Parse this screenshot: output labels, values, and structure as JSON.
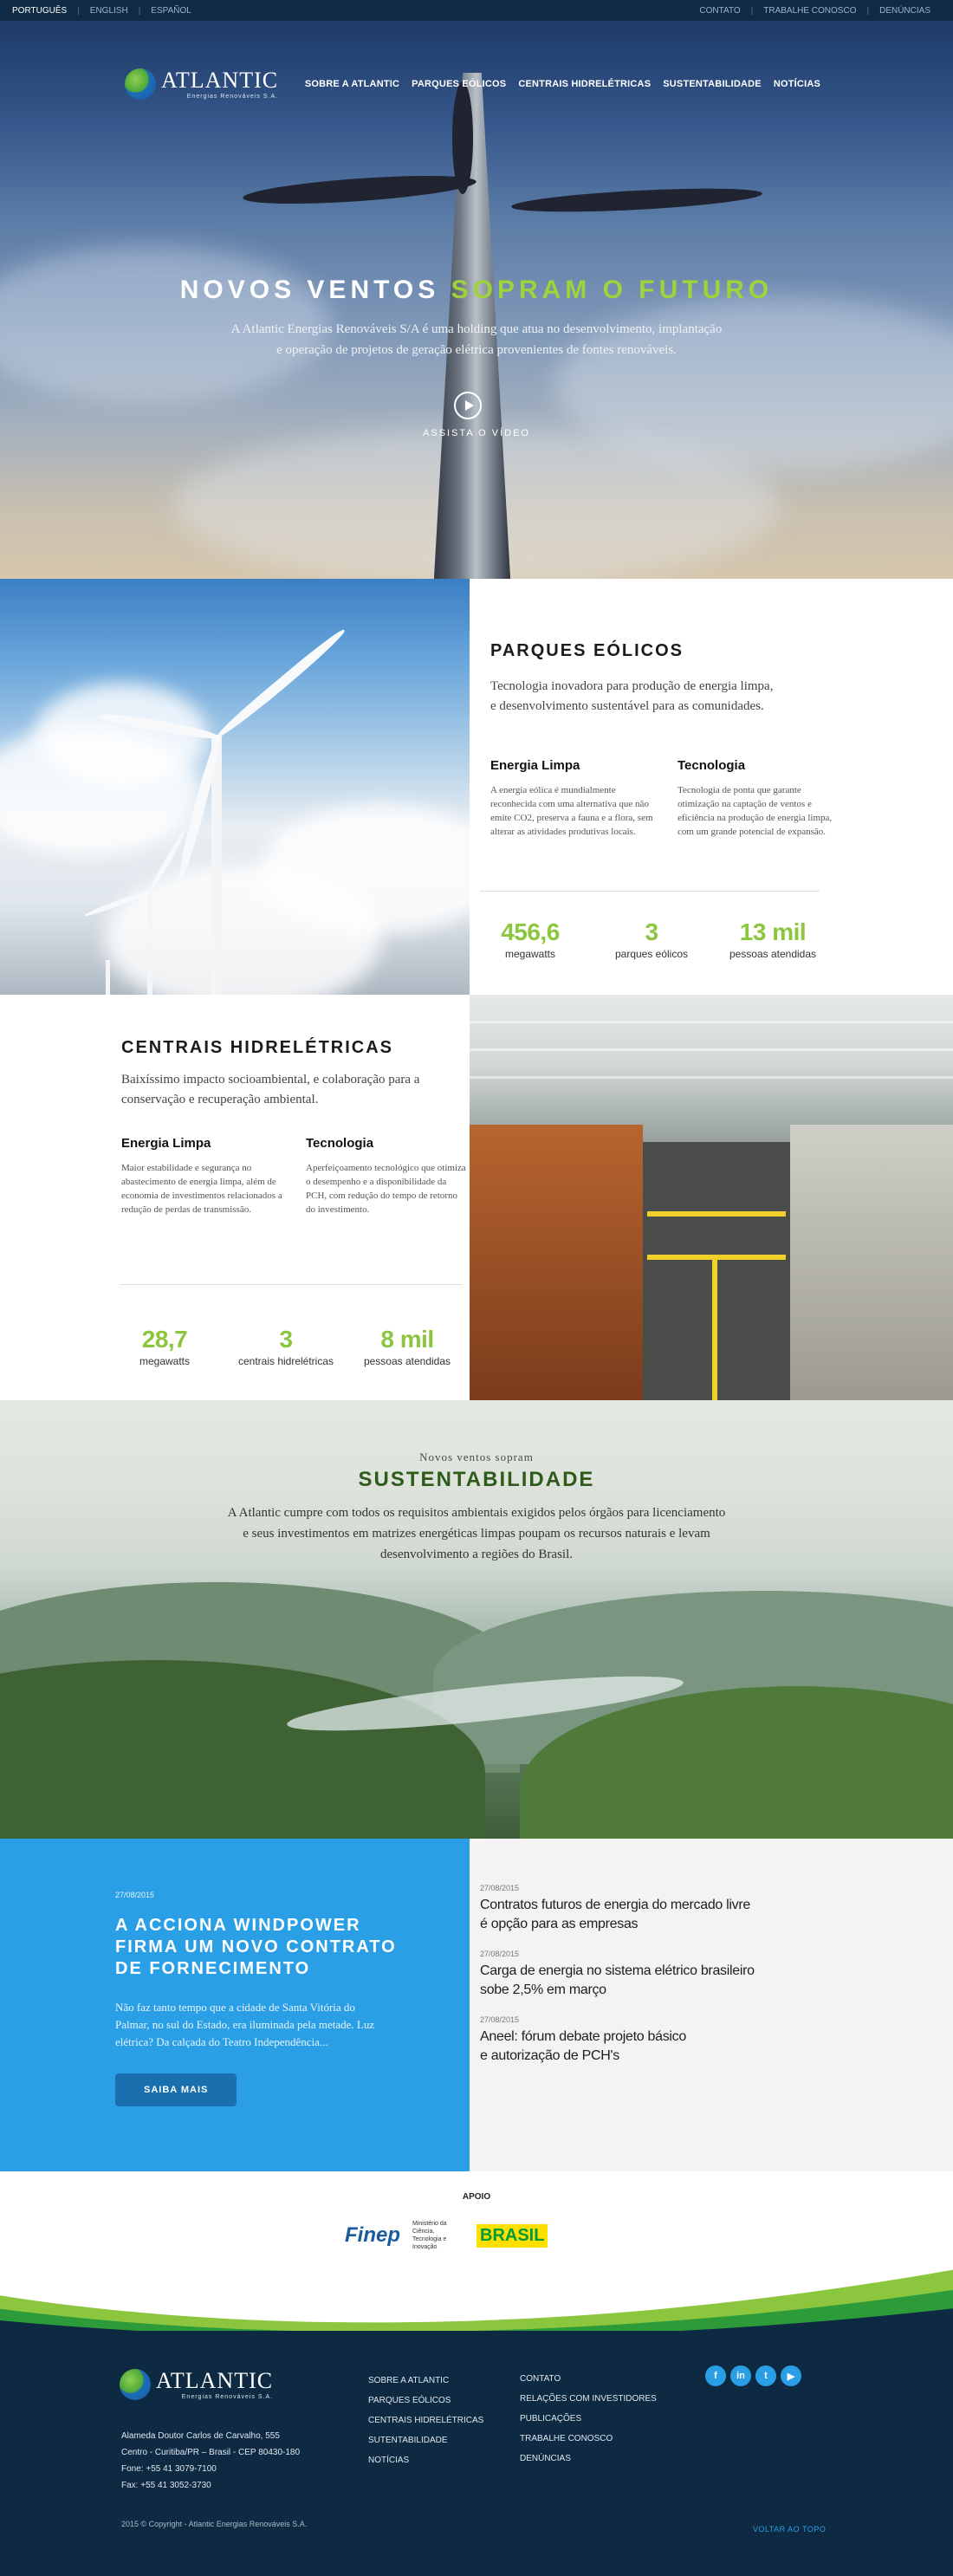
{
  "topbar": {
    "languages": [
      "PORTUGUÊS",
      "ENGLISH",
      "ESPAÑOL"
    ],
    "links": [
      "CONTATO",
      "TRABALHE CONOSCO",
      "DENÚNCIAS"
    ]
  },
  "brand": {
    "name": "ATLANTIC",
    "tagline": "Energias Renováveis S.A."
  },
  "nav": [
    "SOBRE A ATLANTIC",
    "PARQUES EÓLICOS",
    "CENTRAIS HIDRELÉTRICAS",
    "SUSTENTABILIDADE",
    "NOTÍCIAS"
  ],
  "hero": {
    "title_a": "NOVOS VENTOS",
    "title_b": "SOPRAM O FUTURO",
    "line1": "A Atlantic Energias Renováveis S/A é uma holding que atua no desenvolvimento, implantação",
    "line2": "e operação de projetos de geração elétrica provenientes de fontes renováveis.",
    "video_label": "ASSISTA O VÍDEO"
  },
  "wind": {
    "title": "PARQUES EÓLICOS",
    "desc1": "Tecnologia inovadora para produção de energia limpa,",
    "desc2": "e desenvolvimento sustentável para as comunidades.",
    "features": [
      {
        "title": "Energia Limpa",
        "text": "A energia eólica é mundialmente reconhecida com uma alternativa que não emite CO2, preserva a fauna e a flora, sem alterar as atividades produtivas locais."
      },
      {
        "title": "Tecnologia",
        "text": "Tecnologia de ponta que garante otimização na captação de ventos e eficiência na produção de energia limpa, com um grande potencial de expansão."
      }
    ],
    "stats": [
      {
        "value": "456,6",
        "label": "megawatts"
      },
      {
        "value": "3",
        "label": "parques eólicos"
      },
      {
        "value": "13 mil",
        "label": "pessoas atendidas"
      }
    ]
  },
  "hydro": {
    "title": "CENTRAIS HIDRELÉTRICAS",
    "desc1": "Baixíssimo impacto socioambiental, e colaboração para  a",
    "desc2": "conservação e recuperação ambiental.",
    "features": [
      {
        "title": "Energia Limpa",
        "text": "Maior estabilidade e segurança no abastecimento de energia limpa, além de economia de investimentos relacionados a redução de perdas de transmissão."
      },
      {
        "title": "Tecnologia",
        "text": "Aperfeiçoamento tecnológico que otimiza o desempenho e a disponibilidade da PCH, com redução do tempo de retorno do investimento."
      }
    ],
    "stats": [
      {
        "value": "28,7",
        "label": "megawatts"
      },
      {
        "value": "3",
        "label": "centrais hidrelétricas"
      },
      {
        "value": "8 mil",
        "label": "pessoas atendidas"
      }
    ]
  },
  "sust": {
    "pre": "Novos ventos sopram",
    "title": "SUSTENTABILIDADE",
    "line1": "A Atlantic cumpre com todos os requisitos ambientais exigidos pelos órgãos para licenciamento",
    "line2": "e seus investimentos em matrizes energéticas limpas poupam os recursos naturais e levam",
    "line3": "desenvolvimento a regiões do Brasil."
  },
  "news_main": {
    "date": "27/08/2015",
    "title1": "A ACCIONA WINDPOWER",
    "title2": "FIRMA UM NOVO CONTRATO",
    "title3": "DE FORNECIMENTO",
    "text": "Não faz tanto tempo que a cidade de Santa Vitória do Palmar, no sul do Estado, era iluminada pela metade. Luz elétrica?  Da calçada do Teatro Independência...",
    "button": "SAIBA MAIS"
  },
  "news_list": [
    {
      "date": "27/08/2015",
      "l1": "Contratos futuros de energia do mercado livre",
      "l2": "é opção para as empresas"
    },
    {
      "date": "27/08/2015",
      "l1": "Carga de energia no sistema elétrico brasileiro",
      "l2": "sobe 2,5% em março"
    },
    {
      "date": "27/08/2015",
      "l1": "Aneel: fórum debate projeto básico",
      "l2": "e autorização de PCH's"
    }
  ],
  "support": {
    "label": "APOIO",
    "finep": "Finep",
    "mcti": "Ministério da Ciência, Tecnologia e Inovação",
    "brasil": "BRASIL"
  },
  "footer": {
    "address": [
      "Alameda Doutor Carlos de Carvalho, 555",
      "Centro - Curitiba/PR – Brasil - CEP 80430-180",
      "Fone: +55 41 3079-7100",
      "Fax: +55 41 3052-3730"
    ],
    "copyright": "2015 © Copyright - Atlantic Energias Renováveis S.A.",
    "col1": [
      "SOBRE A ATLANTIC",
      "PARQUES EÓLICOS",
      "CENTRAIS HIDRELÉTRICAS",
      "SUTENTABILIDADE",
      "NOTÍCIAS"
    ],
    "col2": [
      "CONTATO",
      "RELAÇÕES COM INVESTIDORES",
      "PUBLICAÇÕES",
      "TRABALHE CONOSCO",
      "DENÚNCIAS"
    ],
    "social": [
      "f",
      "in",
      "t",
      "▶"
    ],
    "back_top": "VOLTAR AO TOPO"
  },
  "colors": {
    "accent_green": "#8cc63f",
    "blue": "#2a9fe6",
    "navy": "#0d2a42"
  }
}
